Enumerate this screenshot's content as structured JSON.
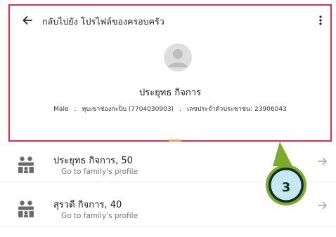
{
  "header": {
    "back_label": "กลับไปยัง โปรไฟล์ของครอบครัว",
    "back_icon": "arrow-left-icon",
    "menu_icon": "more-vert-icon",
    "avatar_icon": "person-avatar-icon",
    "profile_name": "ประยุทธ กิจการ",
    "meta": {
      "gender": "Male",
      "village": "หุบเขาช่องกะปิบ (7704030903)",
      "id_label": "เลขประจำตัวประชาชน: 23906043"
    },
    "highlight_color": "#e5294f",
    "tab_indicator_color": "#f5a623"
  },
  "members": [
    {
      "name_age": "ประยุทธ กิจการ, 50",
      "link_label": "Go to family's profile",
      "icon": "family-icon"
    },
    {
      "name_age": "สุรวดี กิจการ, 40",
      "link_label": "Go to family's profile",
      "icon": "family-icon"
    }
  ],
  "callout": {
    "number": "3",
    "color": "#7cab2b",
    "fill": "#c6e8ee"
  }
}
